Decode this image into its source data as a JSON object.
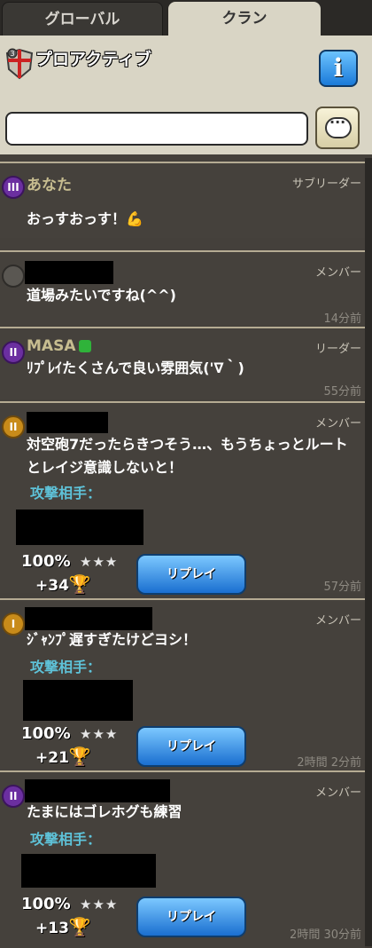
{
  "tabs": [
    {
      "label": "グローバル"
    },
    {
      "label": "クラン"
    }
  ],
  "clan": {
    "name": "プロアクティブ",
    "badge_level": "3"
  },
  "info_label": "i",
  "chat": {
    "placeholder": ""
  },
  "messages": [
    {
      "rank": "III",
      "name": "あなた",
      "role": "サブリーダー",
      "text": "おっすおっす！💪",
      "time": ""
    },
    {
      "rank": "",
      "name": "",
      "role": "メンバー",
      "text": "道場みたいですね(^^)",
      "time": "14分前"
    },
    {
      "rank": "II",
      "name": "MASA",
      "role": "リーダー",
      "text": "ﾘﾌﾟﾚｲたくさんで良い雰囲気('∇｀)",
      "time": "55分前"
    },
    {
      "rank": "II",
      "name": "",
      "role": "メンバー",
      "text": "対空砲7だったらきつそう…、もうちょっとルートとレイジ意識しないと！",
      "time": "57分前",
      "attack_label": "攻撃相手：",
      "percent": "100%",
      "stars": "★★★",
      "trophies": "+34",
      "replay": "リプレイ"
    },
    {
      "rank": "I",
      "name": "",
      "role": "メンバー",
      "text": "ｼﾞｬﾝﾌﾟ遅すぎたけどヨシ！",
      "time": "2時間 2分前",
      "attack_label": "攻撃相手：",
      "percent": "100%",
      "stars": "★★★",
      "trophies": "+21",
      "replay": "リプレイ"
    },
    {
      "rank": "II",
      "name": "",
      "role": "メンバー",
      "text": "たまにはゴレホグも練習",
      "time": "2時間 30分前",
      "attack_label": "攻撃相手：",
      "percent": "100%",
      "stars": "★★★",
      "trophies": "+13",
      "replay": "リプレイ"
    }
  ]
}
